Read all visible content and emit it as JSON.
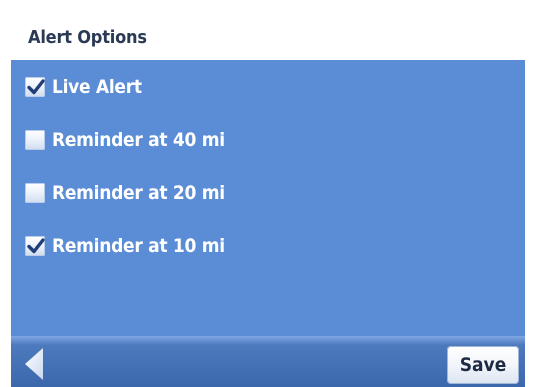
{
  "header": {
    "title": "Alert Options"
  },
  "options": [
    {
      "label": "Live Alert",
      "checked": true
    },
    {
      "label": "Reminder at 40 mi",
      "checked": false
    },
    {
      "label": "Reminder at 20 mi",
      "checked": false
    },
    {
      "label": "Reminder at 10 mi",
      "checked": true
    }
  ],
  "footer": {
    "back_icon": "back-arrow-icon",
    "save_label": "Save"
  },
  "colors": {
    "panel_background": "#5b8cd6",
    "footer_background": "#3b68ad",
    "label_text": "#ffffff",
    "title_text": "#2a3a55"
  }
}
